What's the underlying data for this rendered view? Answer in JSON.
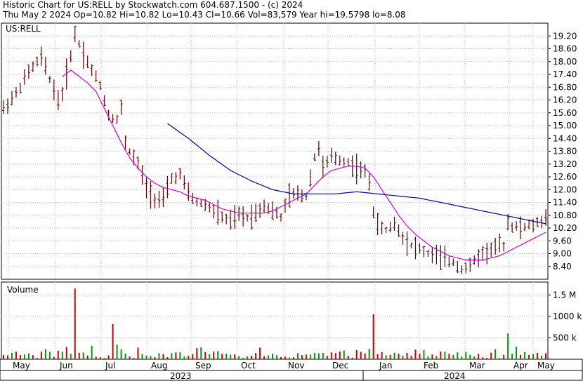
{
  "header": {
    "line1": "Historic Chart for US:RELL by Stockwatch.com 604.687.1500 - (c) 2024",
    "line2": "Thu May  2 2024  Op=10.82  Hi=10.82  Lo=10.43  Cl=10.66  Vol=83,579  Year hi=19.5798  lo=8.08"
  },
  "symbol": "US:RELL",
  "volume_label": "Volume",
  "colors": {
    "candle": "#660000",
    "ma_short": "#dd00dd",
    "ma_long": "#0000aa",
    "volume_up": "#009900",
    "volume_down": "#cc0000",
    "grid": "#bbbbbb"
  },
  "chart_data": {
    "type": "line",
    "price_axis": {
      "ticks": [
        "19.20",
        "18.60",
        "18.00",
        "17.40",
        "16.80",
        "16.20",
        "15.60",
        "15.00",
        "14.40",
        "13.80",
        "13.20",
        "12.60",
        "12.00",
        "11.40",
        "10.80",
        "10.20",
        "9.60",
        "9.00",
        "8.40"
      ],
      "ylim": [
        7.8,
        19.8
      ]
    },
    "volume_axis": {
      "ticks": [
        "1.5 M",
        "1000 k",
        "500 k"
      ],
      "ylim": [
        0,
        1800000
      ]
    },
    "months": [
      "May",
      "Jun",
      "Jul",
      "Aug",
      "Sep",
      "Oct",
      "Nov",
      "Dec",
      "Jan",
      "Feb",
      "Mar",
      "Apr",
      "May"
    ],
    "years": [
      "2023",
      "2024"
    ],
    "price_anchors": [
      [
        0,
        15.8
      ],
      [
        3,
        16.5
      ],
      [
        6,
        17.5
      ],
      [
        9,
        18.2
      ],
      [
        11,
        17.2
      ],
      [
        13,
        16.2
      ],
      [
        14,
        16.5
      ],
      [
        16,
        18.3
      ],
      [
        17,
        19.3
      ],
      [
        19,
        18.4
      ],
      [
        21,
        17.6
      ],
      [
        23,
        16.9
      ],
      [
        25,
        15.5
      ],
      [
        27,
        15.3
      ],
      [
        28,
        15.8
      ],
      [
        29,
        14.2
      ],
      [
        30,
        13.8
      ],
      [
        32,
        13.2
      ],
      [
        34,
        12.1
      ],
      [
        36,
        11.6
      ],
      [
        38,
        11.5
      ],
      [
        40,
        12.5
      ],
      [
        42,
        12.7
      ],
      [
        44,
        11.8
      ],
      [
        46,
        11.4
      ],
      [
        48,
        11.3
      ],
      [
        50,
        11.0
      ],
      [
        52,
        10.7
      ],
      [
        54,
        10.5
      ],
      [
        56,
        10.8
      ],
      [
        58,
        10.7
      ],
      [
        60,
        10.9
      ],
      [
        62,
        11.3
      ],
      [
        64,
        11.0
      ],
      [
        66,
        10.7
      ],
      [
        68,
        11.7
      ],
      [
        70,
        11.8
      ],
      [
        72,
        11.7
      ],
      [
        74,
        13.5
      ],
      [
        75,
        14.0
      ],
      [
        76,
        13.0
      ],
      [
        78,
        13.5
      ],
      [
        80,
        13.4
      ],
      [
        82,
        13.3
      ],
      [
        84,
        13.0
      ],
      [
        86,
        12.8
      ],
      [
        87,
        12.4
      ],
      [
        88,
        11.0
      ],
      [
        89,
        10.3
      ],
      [
        91,
        10.1
      ],
      [
        93,
        10.4
      ],
      [
        95,
        9.8
      ],
      [
        97,
        9.4
      ],
      [
        99,
        9.2
      ],
      [
        101,
        9.0
      ],
      [
        103,
        8.9
      ],
      [
        105,
        8.7
      ],
      [
        107,
        8.6
      ],
      [
        109,
        8.3
      ],
      [
        111,
        8.4
      ],
      [
        113,
        8.9
      ],
      [
        115,
        9.1
      ],
      [
        117,
        9.3
      ],
      [
        119,
        9.4
      ],
      [
        120,
        10.5
      ],
      [
        121,
        10.3
      ],
      [
        123,
        10.2
      ],
      [
        125,
        10.3
      ],
      [
        127,
        10.4
      ],
      [
        129,
        10.7
      ]
    ],
    "ma_short_anchors": [
      [
        14,
        17.3
      ],
      [
        16,
        17.6
      ],
      [
        18,
        17.3
      ],
      [
        20,
        17.0
      ],
      [
        22,
        16.6
      ],
      [
        24,
        15.8
      ],
      [
        26,
        15.0
      ],
      [
        28,
        14.2
      ],
      [
        30,
        13.5
      ],
      [
        32,
        13.0
      ],
      [
        34,
        12.6
      ],
      [
        36,
        12.3
      ],
      [
        38,
        12.1
      ],
      [
        40,
        12.0
      ],
      [
        42,
        11.9
      ],
      [
        44,
        11.7
      ],
      [
        46,
        11.6
      ],
      [
        48,
        11.5
      ],
      [
        50,
        11.3
      ],
      [
        52,
        11.1
      ],
      [
        54,
        11.0
      ],
      [
        56,
        10.9
      ],
      [
        58,
        10.9
      ],
      [
        60,
        10.9
      ],
      [
        62,
        10.9
      ],
      [
        64,
        11.0
      ],
      [
        66,
        11.2
      ],
      [
        68,
        11.4
      ],
      [
        70,
        11.6
      ],
      [
        72,
        11.8
      ],
      [
        74,
        12.2
      ],
      [
        76,
        12.6
      ],
      [
        78,
        12.9
      ],
      [
        80,
        13.0
      ],
      [
        82,
        13.1
      ],
      [
        84,
        13.1
      ],
      [
        86,
        13.0
      ],
      [
        88,
        12.6
      ],
      [
        90,
        12.0
      ],
      [
        92,
        11.4
      ],
      [
        94,
        10.8
      ],
      [
        96,
        10.3
      ],
      [
        98,
        9.9
      ],
      [
        100,
        9.6
      ],
      [
        102,
        9.3
      ],
      [
        104,
        9.1
      ],
      [
        106,
        8.9
      ],
      [
        108,
        8.8
      ],
      [
        110,
        8.7
      ],
      [
        112,
        8.7
      ],
      [
        114,
        8.7
      ],
      [
        116,
        8.8
      ],
      [
        118,
        8.9
      ],
      [
        120,
        9.1
      ],
      [
        122,
        9.3
      ],
      [
        124,
        9.5
      ],
      [
        126,
        9.7
      ],
      [
        128,
        9.9
      ],
      [
        129,
        10.0
      ]
    ],
    "ma_long_anchors": [
      [
        39,
        15.1
      ],
      [
        44,
        14.4
      ],
      [
        49,
        13.6
      ],
      [
        54,
        12.9
      ],
      [
        59,
        12.4
      ],
      [
        64,
        12.0
      ],
      [
        69,
        11.8
      ],
      [
        74,
        11.8
      ],
      [
        79,
        11.8
      ],
      [
        84,
        11.9
      ],
      [
        89,
        11.8
      ],
      [
        94,
        11.7
      ],
      [
        99,
        11.6
      ],
      [
        104,
        11.4
      ],
      [
        109,
        11.2
      ],
      [
        114,
        11.0
      ],
      [
        119,
        10.8
      ],
      [
        124,
        10.6
      ],
      [
        129,
        10.4
      ]
    ],
    "volume_spikes": [
      [
        17,
        1650000,
        "down"
      ],
      [
        26,
        820000,
        "down"
      ],
      [
        88,
        1050000,
        "down"
      ],
      [
        120,
        600000,
        "up"
      ]
    ]
  }
}
